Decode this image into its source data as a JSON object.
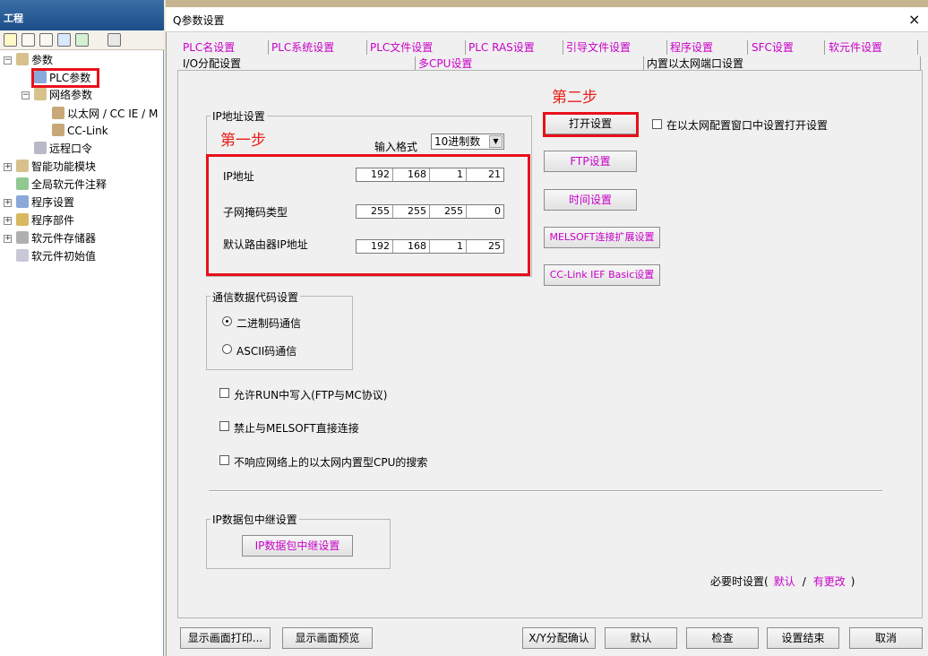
{
  "project": {
    "title": "工程",
    "tree": [
      {
        "label": "参数"
      },
      {
        "label": "PLC参数"
      },
      {
        "label": "网络参数"
      },
      {
        "label": "以太网 / CC IE / M"
      },
      {
        "label": "CC-Link"
      },
      {
        "label": "远程口令"
      },
      {
        "label": "智能功能模块"
      },
      {
        "label": "全局软元件注释"
      },
      {
        "label": "程序设置"
      },
      {
        "label": "程序部件"
      },
      {
        "label": "软元件存储器"
      },
      {
        "label": "软元件初始值"
      }
    ]
  },
  "dialog": {
    "title": "Q参数设置",
    "close": "×",
    "tabs_row1": [
      "PLC名设置",
      "PLC系统设置",
      "PLC文件设置",
      "PLC RAS设置",
      "引导文件设置",
      "程序设置",
      "SFC设置",
      "软元件设置"
    ],
    "tabs_row2": [
      "I/O分配设置",
      "多CPU设置",
      "内置以太网端口设置"
    ]
  },
  "annotations": {
    "step1": "第一步",
    "step2": "第二步"
  },
  "ip_settings": {
    "group_label": "IP地址设置",
    "format_label": "输入格式",
    "format_value": "10进制数",
    "rows": [
      {
        "label": "IP地址",
        "octets": [
          "192",
          "168",
          "1",
          "21"
        ]
      },
      {
        "label": "子网掩码类型",
        "octets": [
          "255",
          "255",
          "255",
          "0"
        ]
      },
      {
        "label": "默认路由器IP地址",
        "octets": [
          "192",
          "168",
          "1",
          "25"
        ]
      }
    ]
  },
  "right_buttons": {
    "open_settings": "打开设置",
    "open_in_config_checkbox": "在以太网配置窗口中设置打开设置",
    "ftp": "FTP设置",
    "time": "时间设置",
    "melsoft_ext": "MELSOFT连接扩展设置",
    "cclink_ief": "CC-Link IEF Basic设置"
  },
  "comm_code": {
    "group_label": "通信数据代码设置",
    "options": [
      "二进制码通信",
      "ASCII码通信"
    ],
    "selected": "二进制码通信"
  },
  "checkboxes": [
    "允许RUN中写入(FTP与MC协议)",
    "禁止与MELSOFT直接连接",
    "不响应网络上的以太网内置型CPU的搜索"
  ],
  "relay": {
    "group_label": "IP数据包中继设置",
    "button": "IP数据包中继设置"
  },
  "required_note": {
    "prefix": "必要时设置(",
    "default": "默认",
    "slash": "/",
    "changed": "有更改",
    "suffix": ")"
  },
  "bottom_buttons": {
    "print": "显示画面打印...",
    "preview": "显示画面预览",
    "xy_confirm": "X/Y分配确认",
    "default": "默认",
    "check": "检查",
    "finish": "设置结束",
    "cancel": "取消"
  },
  "colors": {
    "annotation_red": "#e8201a",
    "magenta_text": "#c800c8"
  }
}
